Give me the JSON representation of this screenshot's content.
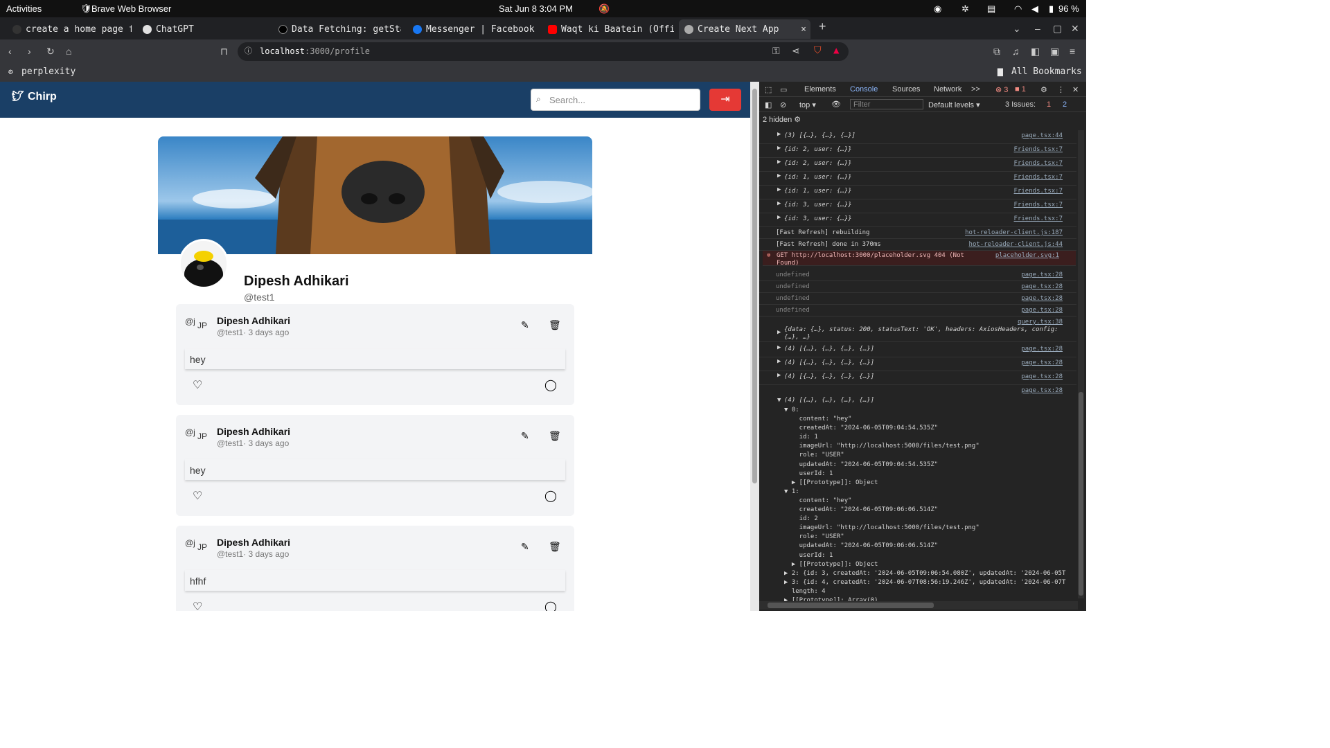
{
  "system_bar": {
    "activities": "Activities",
    "app_name": "Brave Web Browser",
    "datetime": "Sat Jun 8   3:04 PM",
    "battery": "96 %"
  },
  "tabs": [
    {
      "label": "create a home page fo",
      "color": "#333"
    },
    {
      "label": "ChatGPT",
      "color": "#e0e0e0"
    },
    {
      "label": "Data Fetching: getSta",
      "color": "#000"
    },
    {
      "label": "Messenger | Facebook",
      "color": "#1877f2"
    },
    {
      "label": "Waqt ki Baatein (Offi",
      "color": "#ff0000"
    },
    {
      "label": "Create Next App",
      "color": "#aaa",
      "close": "×"
    }
  ],
  "new_tab": "+",
  "address": {
    "host": "localhost",
    "path": ":3000/profile"
  },
  "bookmarks": {
    "item": "perplexity",
    "all": "All Bookmarks"
  },
  "app": {
    "brand": "Chirp",
    "search_placeholder": "Search...",
    "logout_icon": "logout-icon",
    "profile": {
      "name": "Dipesh Adhikari",
      "handle": "@test1"
    },
    "posts": [
      {
        "alt": "@j",
        "initials": "JP",
        "author": "Dipesh Adhikari",
        "meta": "@test1· 3 days ago",
        "content": "hey"
      },
      {
        "alt": "@j",
        "initials": "JP",
        "author": "Dipesh Adhikari",
        "meta": "@test1· 3 days ago",
        "content": "hey"
      },
      {
        "alt": "@j",
        "initials": "JP",
        "author": "Dipesh Adhikari",
        "meta": "@test1· 3 days ago",
        "content": "hfhf"
      }
    ]
  },
  "devtools": {
    "tabs": [
      "Elements",
      "Console",
      "Sources",
      "Network",
      ">>"
    ],
    "errors": "3",
    "warnings": "1",
    "context": "top",
    "filter_placeholder": "Filter",
    "levels": "Default levels",
    "issues": "3 Issues:",
    "issues_err": "1",
    "issues_info": "2",
    "hidden": "2 hidden",
    "logs": [
      {
        "text": "(3) [{…}, {…}, {…}]",
        "src": "page.tsx:44"
      },
      {
        "text": "{id: 2, user: {…}}",
        "src": "Friends.tsx:7"
      },
      {
        "text": "{id: 2, user: {…}}",
        "src": "Friends.tsx:7"
      },
      {
        "text": "{id: 1, user: {…}}",
        "src": "Friends.tsx:7"
      },
      {
        "text": "{id: 1, user: {…}}",
        "src": "Friends.tsx:7"
      },
      {
        "text": "{id: 3, user: {…}}",
        "src": "Friends.tsx:7"
      },
      {
        "text": "{id: 3, user: {…}}",
        "src": "Friends.tsx:7"
      },
      {
        "text": "[Fast Refresh] rebuilding",
        "src": "hot-reloader-client.js:187"
      },
      {
        "text": "[Fast Refresh] done in 370ms",
        "src": "hot-reloader-client.js:44"
      }
    ],
    "error_line": {
      "text": "GET http://localhost:3000/placeholder.svg 404 (Not Found)",
      "src": "placeholder.svg:1"
    },
    "undefined_rows": [
      {
        "text": "undefined",
        "src": "page.tsx:28"
      },
      {
        "text": "undefined",
        "src": "page.tsx:28"
      },
      {
        "text": "undefined",
        "src": "page.tsx:28"
      },
      {
        "text": "undefined",
        "src": "page.tsx:28"
      }
    ],
    "axios": {
      "src": "query.tsx:38",
      "text": "{data: {…}, status: 200, statusText: 'OK', headers: AxiosHeaders, config: {…}, …}"
    },
    "arr_rows": [
      {
        "text": "(4) [{…}, {…}, {…}, {…}]",
        "src": "page.tsx:28"
      },
      {
        "text": "(4) [{…}, {…}, {…}, {…}]",
        "src": "page.tsx:28"
      },
      {
        "text": "(4) [{…}, {…}, {…}, {…}]",
        "src": "page.tsx:28"
      }
    ],
    "expanded": {
      "src": "page.tsx:28",
      "head": "(4) [{…}, {…}, {…}, {…}]",
      "lines": [
        "▼ 0:",
        "    content: \"hey\"",
        "    createdAt: \"2024-06-05T09:04:54.535Z\"",
        "    id: 1",
        "    imageUrl: \"http://localhost:5000/files/test.png\"",
        "    role: \"USER\"",
        "    updatedAt: \"2024-06-05T09:04:54.535Z\"",
        "    userId: 1",
        "  ▶ [[Prototype]]: Object",
        "▼ 1:",
        "    content: \"hey\"",
        "    createdAt: \"2024-06-05T09:06:06.514Z\"",
        "    id: 2",
        "    imageUrl: \"http://localhost:5000/files/test.png\"",
        "    role: \"USER\"",
        "    updatedAt: \"2024-06-05T09:06:06.514Z\"",
        "    userId: 1",
        "  ▶ [[Prototype]]: Object",
        "▶ 2: {id: 3, createdAt: '2024-06-05T09:06:54.080Z', updatedAt: '2024-06-05T",
        "▶ 3: {id: 4, createdAt: '2024-06-07T08:56:19.246Z', updatedAt: '2024-06-07T",
        "  length: 4",
        "▶ [[Prototype]]: Array(0)"
      ]
    }
  }
}
